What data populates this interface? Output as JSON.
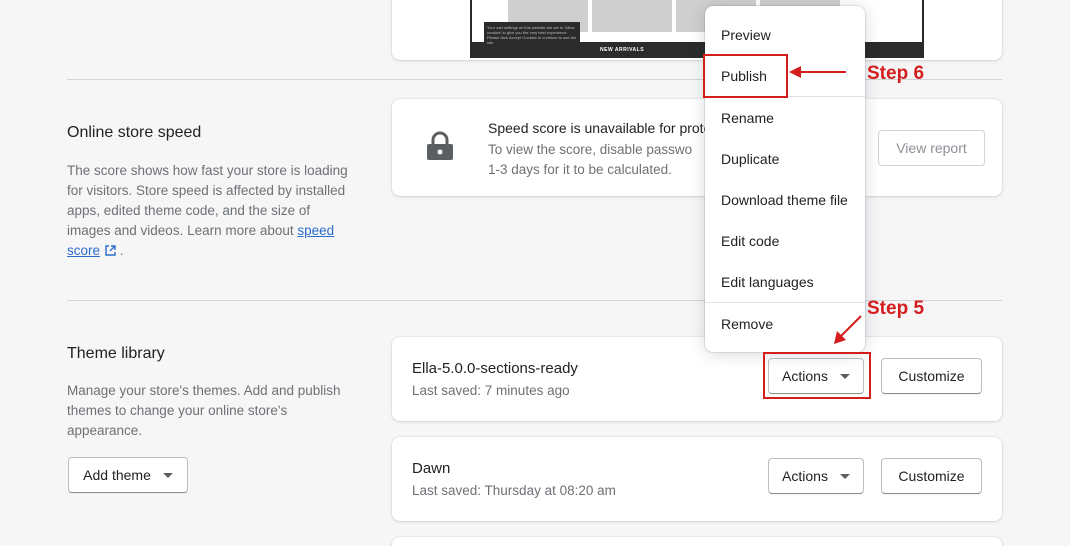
{
  "preview_card": {
    "mini_caption": "NEW ARRIVALS",
    "mini_badge": "w 200px",
    "mini_note_left": "Your cart settings on this website are set to 'Allow cookies' to give you the very best experience. Please click Accept Cookies to continue to use the site.",
    "mini_note_right": "... are set to 'allow ... best experience'"
  },
  "speed_section": {
    "title": "Online store speed",
    "description_prefix": "The score shows how fast your store is loading for visitors. Store speed is affected by installed apps, edited theme code, and the size of images and videos. Learn more about ",
    "link_text": "speed score",
    "description_suffix": " .",
    "card_title": "Speed score is unavailable for prote",
    "card_body": "To view the score, disable passwo",
    "card_body2": "1-3 days for it to be calculated.",
    "view_report_label": "View report"
  },
  "library_section": {
    "title": "Theme library",
    "description": "Manage your store's themes. Add and publish themes to change your online store's appearance.",
    "add_theme_label": "Add theme"
  },
  "themes": [
    {
      "name": "Ella-5.0.0-sections-ready",
      "saved": "Last saved: 7 minutes ago",
      "actions_label": "Actions",
      "customize_label": "Customize"
    },
    {
      "name": "Dawn",
      "saved": "Last saved: Thursday at 08:20 am",
      "actions_label": "Actions",
      "customize_label": "Customize"
    }
  ],
  "actions_menu": {
    "items": [
      "Preview",
      "Publish",
      "Rename",
      "Duplicate",
      "Download theme file",
      "Edit code",
      "Edit languages",
      "Remove"
    ]
  },
  "annotations": {
    "step5": "Step 5",
    "step6": "Step 6",
    "color": "#d41e1e"
  }
}
